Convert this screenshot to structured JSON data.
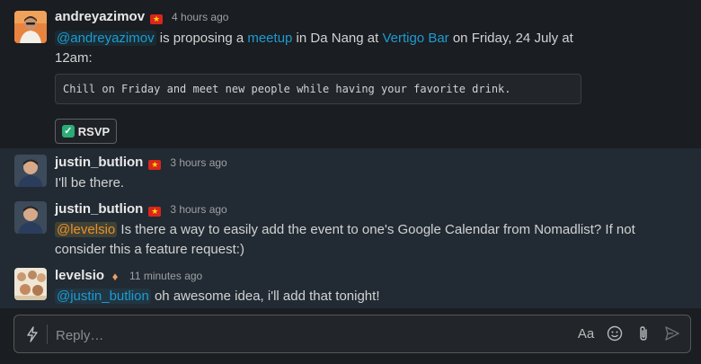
{
  "messages": [
    {
      "user": "andreyazimov",
      "flag": "★",
      "time": "4 hours ago",
      "parts": {
        "mention": "@andreyazimov",
        "t1": " is proposing a ",
        "link1": "meetup",
        "t2": " in Da Nang at ",
        "link2": "Vertigo Bar",
        "t3": " on Friday, 24 July at",
        "t4": "12am:"
      },
      "code": "Chill on Friday and meet new people while having your favorite drink.",
      "rsvp_label": "RSVP"
    },
    {
      "user": "justin_butlion",
      "flag": "★",
      "time": "3 hours ago",
      "text": "I'll be there."
    },
    {
      "user": "justin_butlion",
      "flag": "★",
      "time": "3 hours ago",
      "mention": "@levelsio",
      "text": " Is there a way to easily add the event to one's Google Calendar from Nomadlist? If not consider this a feature request:)"
    },
    {
      "user": "levelsio",
      "flag": "♦",
      "time": "11 minutes ago",
      "mention": "@justin_butlion",
      "text": " oh awesome idea, i'll add that tonight!"
    }
  ],
  "composer": {
    "placeholder": "Reply…",
    "format_label": "Aa",
    "icons": [
      "lightning-icon",
      "format-text-icon",
      "emoji-icon",
      "attach-icon",
      "send-icon"
    ]
  },
  "colors": {
    "background": "#1a1d21",
    "highlight": "#222b33",
    "link": "#1d9bd1",
    "mention_highlight": "#e8912d",
    "flag_red": "#da251d"
  }
}
